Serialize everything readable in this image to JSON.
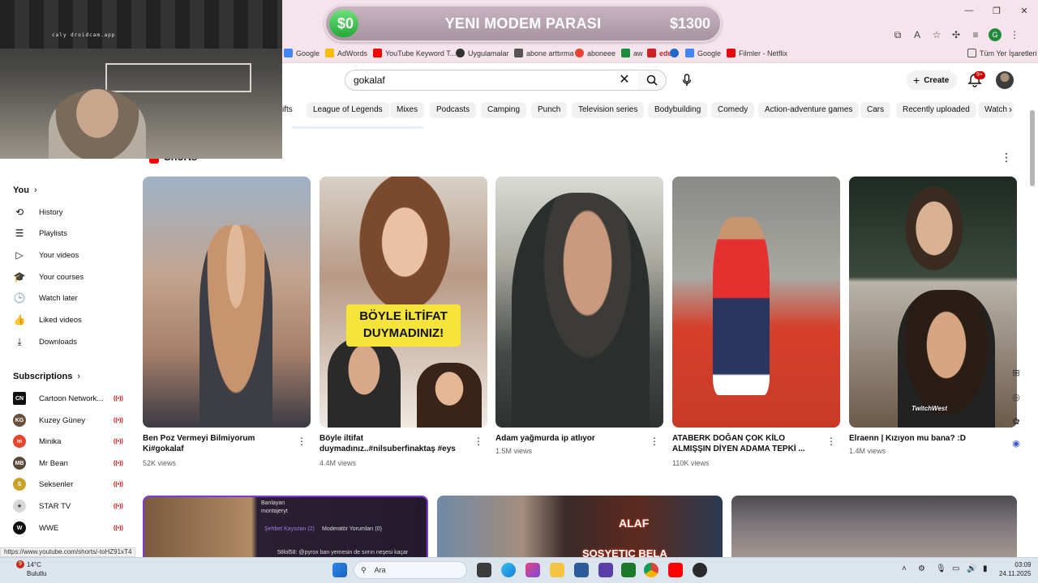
{
  "overlay": {
    "start": "$0",
    "title": "YENI MODEM PARASI",
    "goal": "$1300",
    "progress": 0.0
  },
  "webcam": {
    "label": "caly droidcam.app"
  },
  "bookmarks": [
    {
      "label": "Google",
      "color": "#4285f4"
    },
    {
      "label": "AdWords",
      "color": "#fbbc04"
    },
    {
      "label": "YouTube Keyword T...",
      "color": "#ff0000"
    },
    {
      "label": "Uygulamalar",
      "color": "#333333"
    },
    {
      "label": "abone arttırma",
      "color": "#555555"
    },
    {
      "label": "aboneee",
      "color": "#e94235"
    },
    {
      "label": "aw",
      "color": "#1e8e3e"
    },
    {
      "label": "",
      "color": "#cc2222"
    },
    {
      "label": "",
      "color": "#2266cc"
    },
    {
      "label": "Google",
      "color": "#4285f4"
    },
    {
      "label": "Filmler - Netflix",
      "color": "#e50914"
    }
  ],
  "bookmarks_other": "Tüm Yer İşaretleri",
  "search": {
    "value": "gokalaf"
  },
  "header": {
    "create_label": "Create",
    "notif_count": "9+"
  },
  "chips": [
    "ifts",
    "League of Legends",
    "Mixes",
    "Podcasts",
    "Camping",
    "Punch",
    "Television series",
    "Bodybuilding",
    "Comedy",
    "Action-adventure games",
    "Cars",
    "Recently uploaded",
    "Watch"
  ],
  "sidebar": {
    "you_label": "You",
    "you_items": [
      {
        "label": "History",
        "icon": "history-icon",
        "glyph": "⟲"
      },
      {
        "label": "Playlists",
        "icon": "playlists-icon",
        "glyph": "☰"
      },
      {
        "label": "Your videos",
        "icon": "your-videos-icon",
        "glyph": "▷"
      },
      {
        "label": "Your courses",
        "icon": "courses-icon",
        "glyph": "🎓"
      },
      {
        "label": "Watch later",
        "icon": "clock-icon",
        "glyph": "🕒"
      },
      {
        "label": "Liked videos",
        "icon": "thumbs-up-icon",
        "glyph": "👍"
      },
      {
        "label": "Downloads",
        "icon": "download-icon",
        "glyph": "⤓"
      }
    ],
    "subs_label": "Subscriptions",
    "subscriptions": [
      {
        "label": "Cartoon Network...",
        "abbr": "CN",
        "color": "#111111"
      },
      {
        "label": "Kuzey Güney",
        "abbr": "KG",
        "color": "#6b4f3a"
      },
      {
        "label": "Minika",
        "abbr": "m",
        "color": "#e8462c"
      },
      {
        "label": "Mr Bean",
        "abbr": "MB",
        "color": "#5a4a3a"
      },
      {
        "label": "Seksenler",
        "abbr": "S",
        "color": "#c9a227"
      },
      {
        "label": "STAR TV",
        "abbr": "★",
        "color": "#d8d8d8"
      },
      {
        "label": "WWE",
        "abbr": "W",
        "color": "#111111"
      }
    ]
  },
  "shorts": {
    "title": "Shorts",
    "cards": [
      {
        "title": "Ben Poz Vermeyi Bilmiyorum Ki#gokalaf",
        "views": "52K views"
      },
      {
        "title": "Böyle iltifat duymadınız..#nilsuberfinaktaş #eys",
        "views": "4.4M views",
        "caption": "BÖYLE İLTİFAT DUYMADINIZ!"
      },
      {
        "title": "Adam yağmurda ip atlıyor",
        "views": "1.5M views"
      },
      {
        "title": "ATABERK DOĞAN ÇOK KİLO ALMIŞŞIN DİYEN ADAMA TEPKİ ...",
        "views": "110K views"
      },
      {
        "title": "Elraenn | Kızıyon mu bana? :D",
        "views": "1.4M views",
        "tag": "TwitchWest"
      }
    ]
  },
  "row2": {
    "chat_lines": [
      "Banlayan",
      "montajeryt",
      "Şehbet Kaysıtan (2)",
      "Moderatör Yorumları (0)",
      "58lol58: @pyrox ban yemesin de sırrın neşesi kaçar"
    ],
    "game_title": "ALAF",
    "game_sub": "SOSYETIC BELA"
  },
  "status_url": "https://www.youtube.com/shorts/-toHZ91xT4",
  "taskbar": {
    "weather_temp": "14°C",
    "weather_desc": "Bulutlu",
    "weather_badge": "9",
    "search_label": "Ara",
    "time": "03:09",
    "date": "24.11.2025"
  }
}
